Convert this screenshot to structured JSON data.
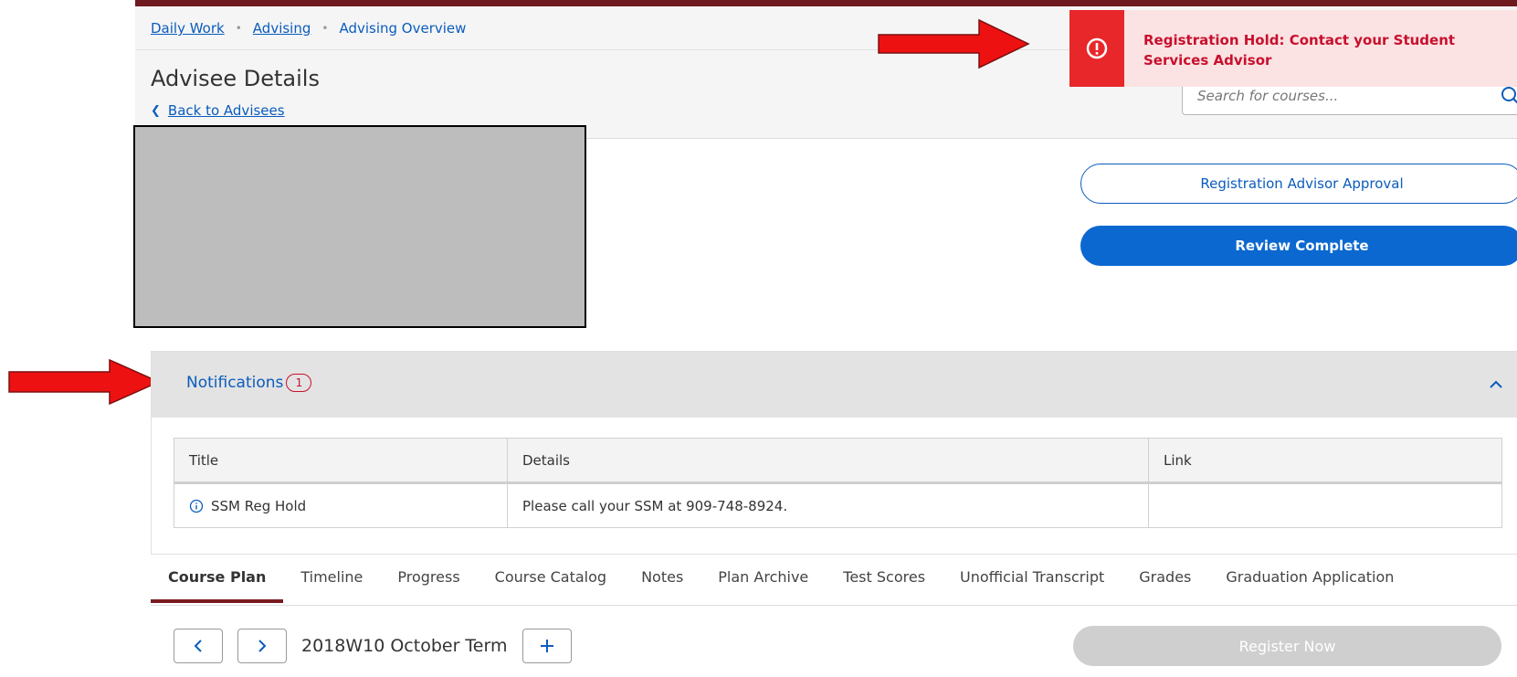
{
  "breadcrumb": {
    "items": [
      "Daily Work",
      "Advising"
    ],
    "current": "Advising Overview",
    "separator": "•"
  },
  "page": {
    "title": "Advisee Details",
    "back_link": "Back to Advisees"
  },
  "search": {
    "placeholder": "Search for courses..."
  },
  "toast": {
    "message": "Registration Hold: Contact your Student Services Advisor"
  },
  "actions": {
    "approval_label": "Registration Advisor Approval",
    "review_label": "Review Complete"
  },
  "notifications": {
    "title": "Notifications",
    "count": "1",
    "columns": [
      "Title",
      "Details",
      "Link"
    ],
    "rows": [
      {
        "title": "SSM Reg Hold",
        "details": "Please call your SSM at 909-748-8924.",
        "link": ""
      }
    ]
  },
  "tabs": [
    "Course Plan",
    "Timeline",
    "Progress",
    "Course Catalog",
    "Notes",
    "Plan Archive",
    "Test Scores",
    "Unofficial Transcript",
    "Grades",
    "Graduation Application"
  ],
  "plan": {
    "term": "2018W10 October Term",
    "register_label": "Register Now"
  },
  "colors": {
    "accent_blue": "#0b5cbd",
    "primary_button": "#0b68d0",
    "alert_red": "#e8272a",
    "alert_bg": "#fbe3e3",
    "tab_active": "#7a1b21",
    "annotation_arrow": "#ee1111"
  }
}
